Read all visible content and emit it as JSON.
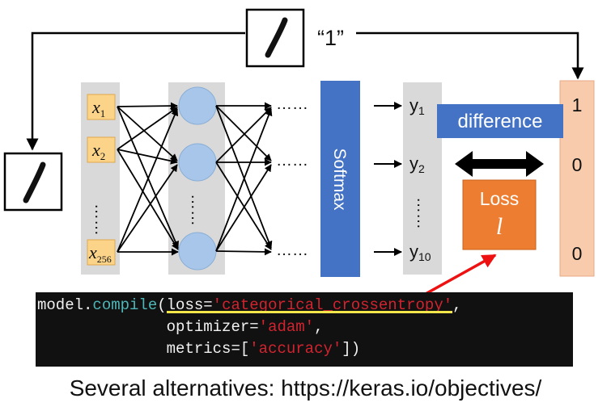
{
  "target_label": "“1”",
  "inputs": {
    "var": "x",
    "subs": [
      "1",
      "2",
      "256"
    ],
    "dots": "……"
  },
  "hidden_dots": "……",
  "row_dots": "……",
  "softmax_label": "Softmax",
  "outputs": {
    "var": "y",
    "subs": [
      "1",
      "2",
      "10"
    ],
    "dots": "……"
  },
  "difference_label": "difference",
  "loss": {
    "title": "Loss",
    "symbol": "l"
  },
  "target_vector": {
    "values": [
      "1",
      "0",
      "0"
    ],
    "dots": "……"
  },
  "code": {
    "line1_prefix": "model.",
    "line1_fn": "compile",
    "line1_open": "(",
    "line1_kw": "loss=",
    "line1_str": "'categorical_crossentropy'",
    "line1_end": ",",
    "line2_indent": "              ",
    "line2_kw": "optimizer=",
    "line2_str": "'adam'",
    "line2_end": ",",
    "line3_indent": "              ",
    "line3_kw": "metrics=[",
    "line3_str": "'accuracy'",
    "line3_end": "])"
  },
  "caption": "Several alternatives: https://keras.io/objectives/",
  "colors": {
    "input_box": "#fbd48a",
    "neuron": "#a7c6ea",
    "softmax": "#4472c4",
    "difference": "#4472c4",
    "loss": "#ed7d31",
    "target_column": "#f8cbad",
    "column_bg": "#d9d9d9",
    "red_arrow": "#ee1111"
  },
  "icons": [
    "handwritten-digit-one-icon"
  ]
}
